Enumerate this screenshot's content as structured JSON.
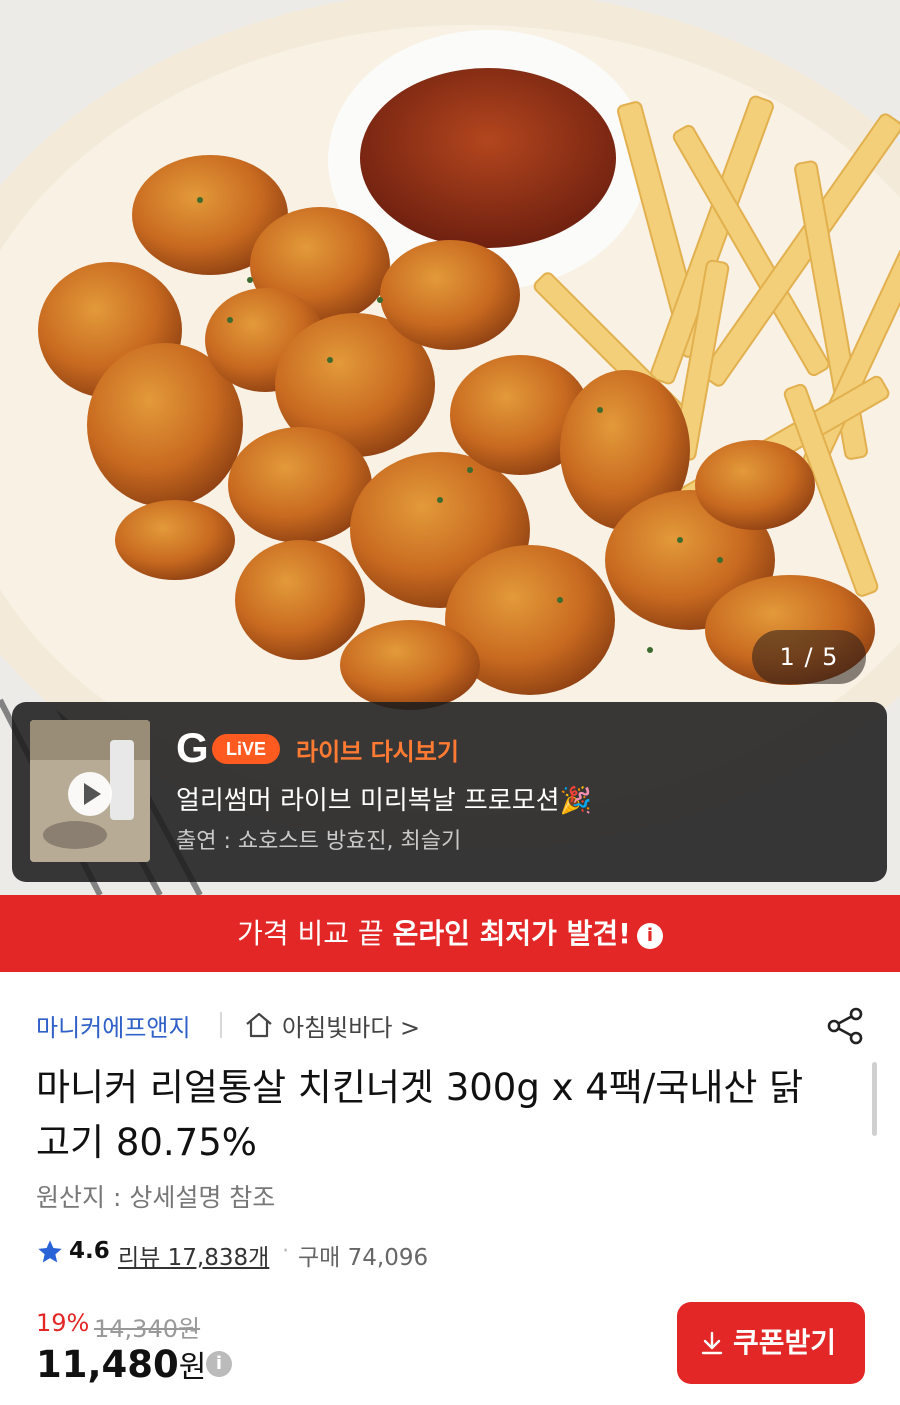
{
  "hero": {
    "counter": "1 / 5"
  },
  "live": {
    "logo_g": "G",
    "logo_live": "LiVE",
    "replay_label": "라이브 다시보기",
    "title": "얼리썸머 라이브 미리복날 프로모션🎉",
    "cast": "출연 : 쇼호스트 방효진, 최슬기"
  },
  "banner": {
    "text_plain": "가격 비교 끝 ",
    "text_bold": "온라인 최저가 발견!",
    "info": "i"
  },
  "product": {
    "brand": "마니커에프앤지",
    "store": "아침빛바다 >",
    "title": "마니커 리얼통살 치킨너겟 300g x 4팩/국내산 닭고기 80.75%",
    "origin": "원산지 : 상세설명 참조",
    "rating": "4.6",
    "reviews": "리뷰 17,838개",
    "purchases": "구매 74,096",
    "discount": "19%",
    "original_price": "14,340원",
    "price": "11,480",
    "price_unit": "원",
    "price_info": "i",
    "coupon_label": "쿠폰받기"
  },
  "colors": {
    "accent": "#e32626",
    "live_orange": "#ff5a1f",
    "brand_blue": "#3060c8"
  }
}
